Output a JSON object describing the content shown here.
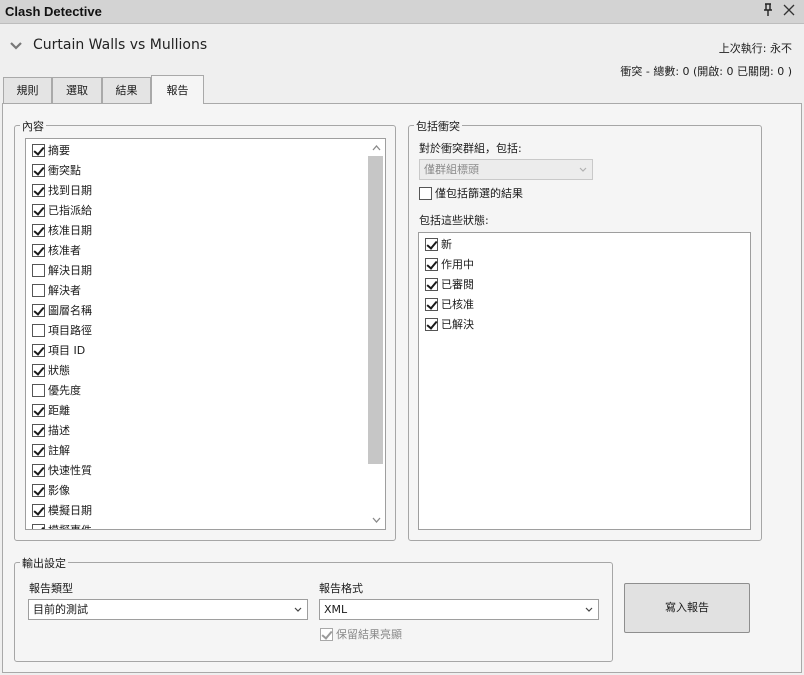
{
  "window": {
    "title": "Clash Detective",
    "pin_glyph": "ꟸ",
    "icons": {
      "pin": "pin-icon",
      "close": "close-icon"
    }
  },
  "test": {
    "name": "Curtain Walls vs Mullions",
    "last_run": "上次執行:  永不",
    "clash_summary": "衝突 -  總數: 0  (開啟: 0  已關閉: 0 )"
  },
  "tabs": [
    {
      "label": "規則",
      "active": false
    },
    {
      "label": "選取",
      "active": false
    },
    {
      "label": "結果",
      "active": false
    },
    {
      "label": "報告",
      "active": true
    }
  ],
  "content": {
    "legend": "內容",
    "items": [
      {
        "label": "摘要",
        "checked": true
      },
      {
        "label": "衝突點",
        "checked": true
      },
      {
        "label": "找到日期",
        "checked": true
      },
      {
        "label": "已指派給",
        "checked": true
      },
      {
        "label": "核准日期",
        "checked": true
      },
      {
        "label": "核准者",
        "checked": true
      },
      {
        "label": "解決日期",
        "checked": false
      },
      {
        "label": "解決者",
        "checked": false
      },
      {
        "label": "圖層名稱",
        "checked": true
      },
      {
        "label": "項目路徑",
        "checked": false
      },
      {
        "label": "項目 ID",
        "checked": true
      },
      {
        "label": "狀態",
        "checked": true
      },
      {
        "label": "優先度",
        "checked": false
      },
      {
        "label": "距離",
        "checked": true
      },
      {
        "label": "描述",
        "checked": true
      },
      {
        "label": "註解",
        "checked": true
      },
      {
        "label": "快速性質",
        "checked": true
      },
      {
        "label": "影像",
        "checked": true
      },
      {
        "label": "模擬日期",
        "checked": true
      },
      {
        "label": "模擬事件",
        "checked": true
      }
    ],
    "scroll_position": 0.0
  },
  "include_clashes": {
    "legend": "包括衝突",
    "for_groups_label": "對於衝突群組，包括:",
    "group_combo_value": "僅群組標頭",
    "filtered_only_label": "僅包括篩選的結果",
    "filtered_only_checked": false,
    "statuses_label": "包括這些狀態:",
    "statuses": [
      {
        "label": "新",
        "checked": true
      },
      {
        "label": "作用中",
        "checked": true
      },
      {
        "label": "已審閱",
        "checked": true
      },
      {
        "label": "已核准",
        "checked": true
      },
      {
        "label": "已解決",
        "checked": true
      }
    ]
  },
  "output": {
    "legend": "輸出設定",
    "report_type_label": "報告類型",
    "report_type_value": "目前的測試",
    "report_format_label": "報告格式",
    "report_format_value": "XML",
    "keep_highlighting_label": "保留結果亮顯",
    "keep_highlighting_checked": true
  },
  "write_report_label": "寫入報告"
}
